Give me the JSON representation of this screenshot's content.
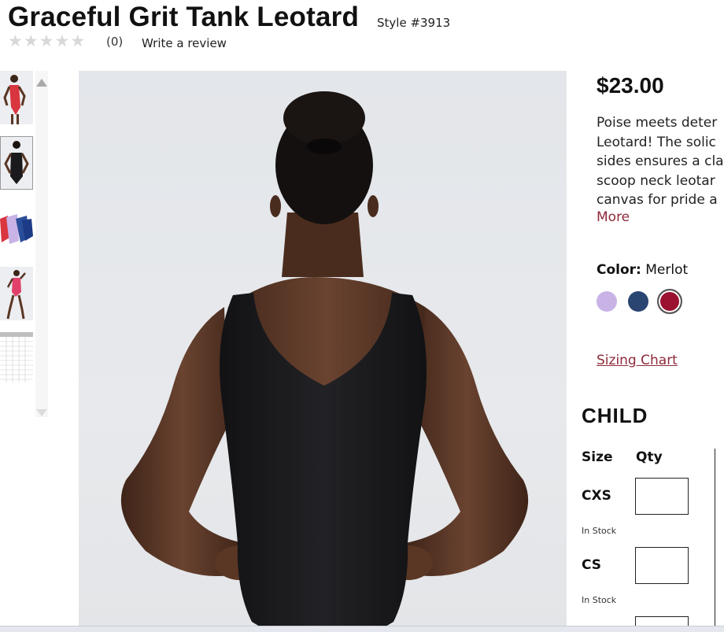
{
  "product": {
    "title": "Graceful Grit Tank Leotard",
    "style_number": "Style #3913",
    "rating": {
      "stars_filled": 0,
      "stars_total": 5,
      "count_text": "(0)"
    },
    "write_review_label": "Write a review",
    "price": "$23.00",
    "description_lines": [
      "Poise meets deter",
      "Leotard! The solic",
      "sides ensures a cla",
      "scoop neck leotar",
      "canvas for pride a"
    ],
    "more_label": "More"
  },
  "thumbnails": [
    {
      "name": "front-red",
      "selected": false
    },
    {
      "name": "back-black",
      "selected": true
    },
    {
      "name": "colorway-stack",
      "selected": false
    },
    {
      "name": "pose-red",
      "selected": false
    },
    {
      "name": "size-chart",
      "selected": false
    }
  ],
  "color": {
    "label": "Color:",
    "selected": "Merlot",
    "swatches": [
      {
        "name": "lavender",
        "hex": "#c9b3e6"
      },
      {
        "name": "navy",
        "hex": "#2b4572"
      },
      {
        "name": "merlot",
        "hex": "#9b1230"
      }
    ]
  },
  "sizing_chart_label": "Sizing Chart",
  "size_table": {
    "heading": "CHILD",
    "size_col": "Size",
    "qty_col": "Qty",
    "rows": [
      {
        "size": "CXS",
        "stock": "In Stock",
        "qty": ""
      },
      {
        "size": "CS",
        "stock": "In Stock",
        "qty": ""
      },
      {
        "size": "",
        "stock": "",
        "qty": ""
      }
    ]
  },
  "colors": {
    "accent": "#8e2a3a",
    "text": "#111111",
    "image_bg": "#e5e7ea",
    "leotard": "#1a1a1c",
    "skin": "#5a3624"
  }
}
